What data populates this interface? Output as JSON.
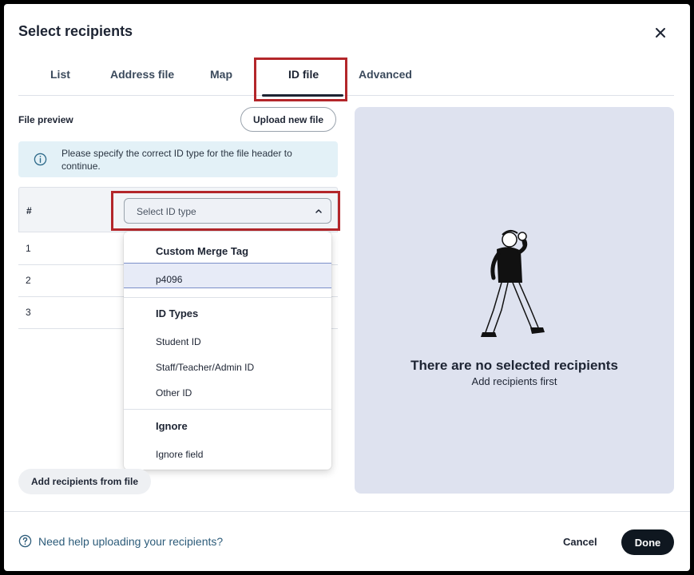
{
  "dialog": {
    "title": "Select recipients"
  },
  "tabs": [
    {
      "label": "List"
    },
    {
      "label": "Address file"
    },
    {
      "label": "Map"
    },
    {
      "label": "ID file",
      "active": true
    },
    {
      "label": "Advanced"
    }
  ],
  "file_preview": {
    "label": "File preview",
    "upload_button": "Upload new file",
    "info_message": "Please specify the correct ID type for the file header to continue.",
    "table": {
      "header_hash": "#",
      "rows": [
        "1",
        "2",
        "3"
      ]
    },
    "select": {
      "placeholder": "Select ID type"
    },
    "dropdown": {
      "groups": [
        {
          "label": "Custom Merge Tag",
          "items": [
            "p4096"
          ]
        },
        {
          "label": "ID Types",
          "items": [
            "Student ID",
            "Staff/Teacher/Admin ID",
            "Other ID"
          ]
        },
        {
          "label": "Ignore",
          "items": [
            "Ignore field"
          ]
        }
      ],
      "selected_item": "p4096"
    },
    "add_button": "Add recipients from file"
  },
  "recipients_panel": {
    "empty_title": "There are no selected recipients",
    "empty_subtitle": "Add recipients first"
  },
  "footer": {
    "help_link": "Need help uploading your recipients?",
    "cancel": "Cancel",
    "done": "Done"
  },
  "icons": {
    "close": "close-icon",
    "info": "info-icon",
    "chevron": "chevron-up-icon",
    "help": "help-icon"
  },
  "colors": {
    "highlight": "#b3262a",
    "panel_bg": "#dee2ef",
    "info_bg": "#e3f1f7",
    "primary_button": "#0f1720",
    "link": "#2d5c7a"
  }
}
